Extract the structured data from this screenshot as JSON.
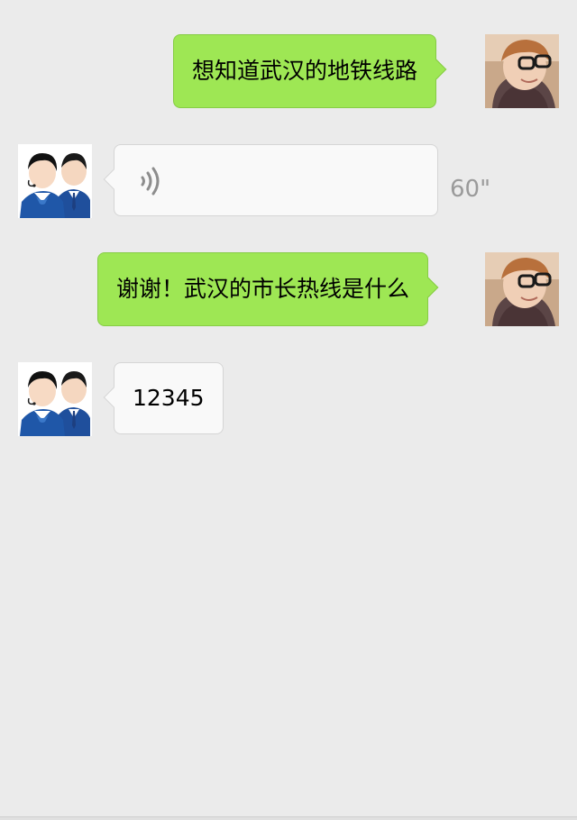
{
  "chat": {
    "messages": [
      {
        "side": "right",
        "type": "text",
        "text": "想知道武汉的地铁线路",
        "avatar": "user-avatar"
      },
      {
        "side": "left",
        "type": "voice",
        "duration": "60\"",
        "icon": "voice-wave-icon",
        "avatar": "service-avatar"
      },
      {
        "side": "right",
        "type": "text",
        "text": "谢谢！武汉的市长热线是什么",
        "avatar": "user-avatar"
      },
      {
        "side": "left",
        "type": "text",
        "text": "12345",
        "avatar": "service-avatar"
      }
    ]
  },
  "colors": {
    "background": "#ebebeb",
    "user_bubble": "#9ee754",
    "service_bubble": "#f9f9f9",
    "duration_text": "#9a9a9a"
  }
}
